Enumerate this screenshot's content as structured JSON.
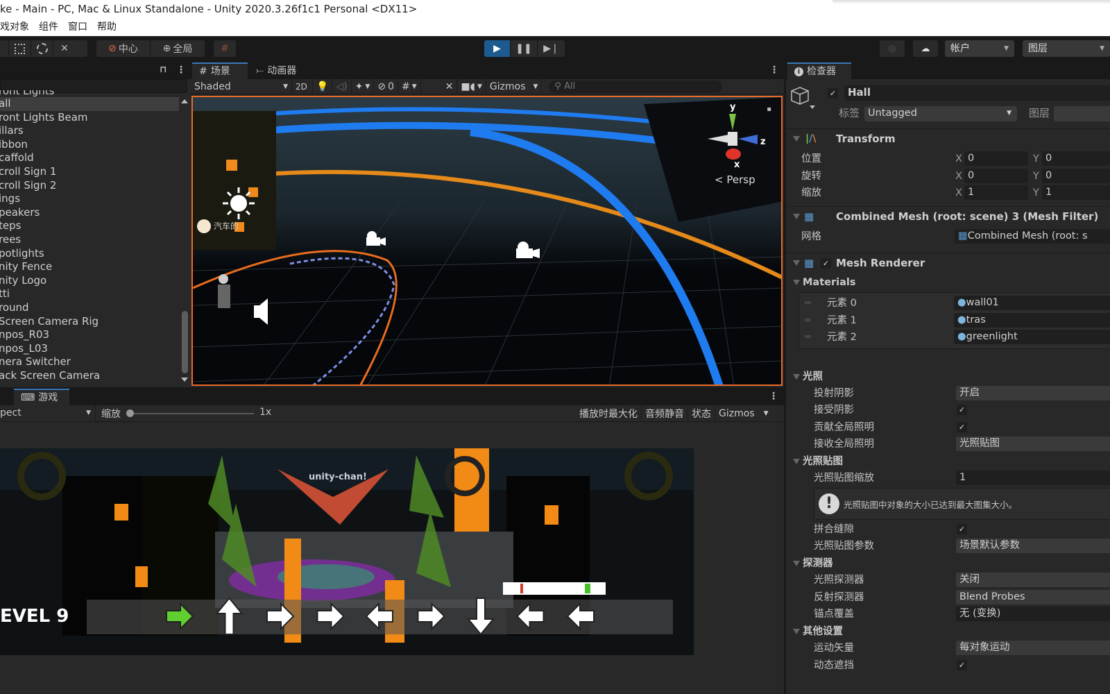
{
  "window": {
    "title": "ke - Main - PC, Mac & Linux Standalone - Unity 2020.3.26f1c1 Personal <DX11>"
  },
  "menu": [
    "戏对象",
    "组件",
    "窗口",
    "帮助"
  ],
  "toolbar": {
    "tools": [
      "rect-tool",
      "transform-tool",
      "custom-tool"
    ],
    "pivot": "中心",
    "space": "全局",
    "play_colors": {
      "active": "#1c5a8f"
    },
    "account": "帐户",
    "layers": "图层"
  },
  "hierarchy": {
    "items": [
      "ront Lights",
      "all",
      "ront Lights Beam",
      "illars",
      "ibbon",
      "caffold",
      "croll Sign 1",
      "croll Sign 2",
      "ings",
      "peakers",
      "teps",
      "rees",
      "potlights",
      "nity Fence",
      "nity Logo",
      "tti",
      "round",
      "Screen Camera Rig",
      "npos_R03",
      "npos_L03",
      "nera Switcher",
      "ack Screen Camera"
    ],
    "selected_index": 1
  },
  "scene": {
    "tabs": [
      "场景",
      "动画器"
    ],
    "shading": "Shaded",
    "mode2d": "2D",
    "hidden_count": "0",
    "gizmos": "Gizmos",
    "search_placeholder": "All",
    "gizmo": {
      "y": "y",
      "x": "x",
      "z": "z",
      "persp": "Persp"
    },
    "overlay_label": "汽车的",
    "selection_color": "#e96a28"
  },
  "game": {
    "tab": "游戏",
    "aspect": "pect",
    "zoom_label": "缩放",
    "zoom_value": "1x",
    "zoom_fraction": 0,
    "buttons": [
      "播放时最大化",
      "音频静音",
      "状态",
      "Gizmos"
    ],
    "hud": {
      "level": "EVEL 9",
      "arrows": [
        "right",
        "up",
        "right",
        "right",
        "left",
        "right",
        "down",
        "left",
        "left"
      ],
      "highlight_index": 0,
      "logo": "unity-chan!"
    }
  },
  "inspector": {
    "tab": "检查器",
    "object_name": "Hall",
    "active": true,
    "tag_label": "标签",
    "tag": "Untagged",
    "layer_label": "图层",
    "transform": {
      "title": "Transform",
      "rows": [
        {
          "label": "位置",
          "x": "0",
          "y": "0"
        },
        {
          "label": "旋转",
          "x": "0",
          "y": "0"
        },
        {
          "label": "缩放",
          "x": "1",
          "y": "1"
        }
      ]
    },
    "mesh_filter": {
      "title": "Combined Mesh (root: scene) 3 (Mesh Filter)",
      "mesh_label": "网格",
      "mesh_value": "Combined Mesh (root: s"
    },
    "mesh_renderer": {
      "title": "Mesh Renderer",
      "enabled": true
    },
    "materials": {
      "title": "Materials",
      "items": [
        {
          "label": "元素 0",
          "value": "wall01"
        },
        {
          "label": "元素 1",
          "value": "tras"
        },
        {
          "label": "元素 2",
          "value": "greenlight"
        }
      ]
    },
    "lighting": {
      "title": "光照",
      "cast_shadows_label": "投射阴影",
      "cast_shadows": "开启",
      "receive_shadows_label": "接受阴影",
      "receive_shadows": true,
      "contribute_gi_label": "贡献全局照明",
      "contribute_gi": true,
      "receive_gi_label": "接收全局照明",
      "receive_gi": "光照贴图"
    },
    "lightmapping": {
      "title": "光照贴图",
      "scale_label": "光照贴图缩放",
      "scale": "1",
      "warning": "光照贴图中对象的大小已达到最大图集大小。",
      "stitch_label": "拼合缝隙",
      "stitch": true,
      "params_label": "光照贴图参数",
      "params": "场景默认参数"
    },
    "probes": {
      "title": "探测器",
      "light_label": "光照探测器",
      "light": "关闭",
      "reflection_label": "反射探测器",
      "reflection": "Blend Probes",
      "anchor_label": "锚点覆盖",
      "anchor": "无 (变换)"
    },
    "other": {
      "title": "其他设置",
      "motion_label": "运动矢量",
      "motion": "每对象运动",
      "occlusion_label": "动态遮挡",
      "occlusion": true
    }
  }
}
